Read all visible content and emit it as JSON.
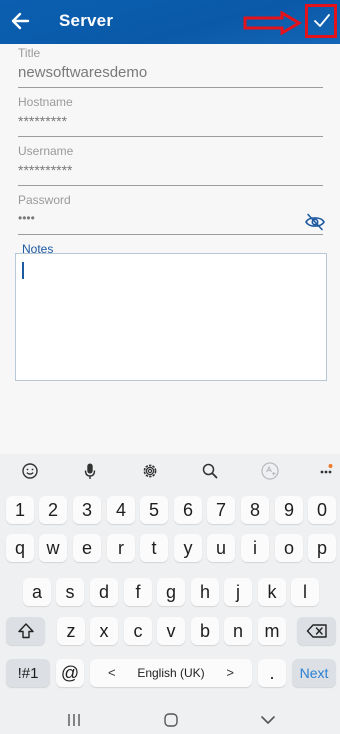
{
  "header": {
    "title": "Server"
  },
  "form": {
    "title": {
      "label": "Title",
      "value": "newsoftwaresdemo"
    },
    "hostname": {
      "label": "Hostname",
      "value": "*********"
    },
    "username": {
      "label": "Username",
      "value": "**********"
    },
    "password": {
      "label": "Password",
      "value": "••••"
    },
    "notes": {
      "label": "Notes",
      "value": ""
    }
  },
  "keyboard": {
    "row_numbers": [
      "1",
      "2",
      "3",
      "4",
      "5",
      "6",
      "7",
      "8",
      "9",
      "0"
    ],
    "row_top": [
      "q",
      "w",
      "e",
      "r",
      "t",
      "y",
      "u",
      "i",
      "o",
      "p"
    ],
    "row_home": [
      "a",
      "s",
      "d",
      "f",
      "g",
      "h",
      "j",
      "k",
      "l"
    ],
    "row_bottom": [
      "z",
      "x",
      "c",
      "v",
      "b",
      "n",
      "m"
    ],
    "symbols_label": "!#1",
    "at_label": "@",
    "space_label": "English (UK)",
    "left_arrow": "<",
    "right_arrow": ">",
    "period_label": ".",
    "action_label": "Next"
  },
  "colors": {
    "header_bg": "#0b5fb0",
    "accent": "#1d5aa0",
    "annotation": "#e3121b"
  }
}
